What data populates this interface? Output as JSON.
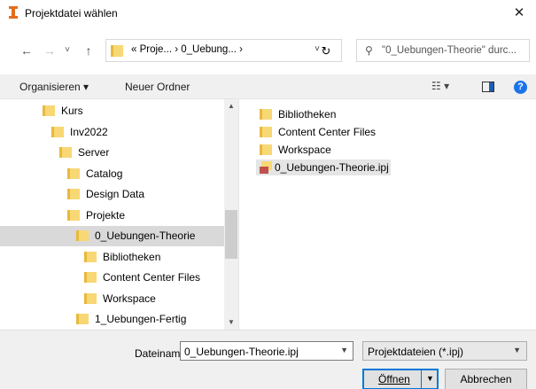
{
  "window": {
    "title": "Projektdatei wählen",
    "close": "✕"
  },
  "nav": {
    "back": "←",
    "forward": "→",
    "recent": "˅",
    "up": "↑",
    "address": "« Proje... › 0_Uebung... ›",
    "address_dropdown": "˅",
    "refresh": "↻",
    "search_placeholder": "\"0_Uebungen-Theorie\" durc..."
  },
  "toolbar": {
    "organize": "Organisieren ▾",
    "new_folder": "Neuer Ordner",
    "view": "☷ ▾",
    "help": "?"
  },
  "tree": {
    "items": [
      {
        "label": "Kurs",
        "indent": 1
      },
      {
        "label": "Inv2022",
        "indent": 2
      },
      {
        "label": "Server",
        "indent": 3
      },
      {
        "label": "Catalog",
        "indent": 4
      },
      {
        "label": "Design Data",
        "indent": 4
      },
      {
        "label": "Projekte",
        "indent": 4
      },
      {
        "label": "0_Uebungen-Theorie",
        "indent": 5,
        "selected": true
      },
      {
        "label": "Bibliotheken",
        "indent": 6
      },
      {
        "label": "Content Center Files",
        "indent": 6
      },
      {
        "label": "Workspace",
        "indent": 6
      },
      {
        "label": "1_Uebungen-Fertig",
        "indent": 5
      }
    ]
  },
  "files": {
    "items": [
      {
        "label": "Bibliotheken",
        "type": "folder"
      },
      {
        "label": "Content Center Files",
        "type": "folder"
      },
      {
        "label": "Workspace",
        "type": "folder"
      },
      {
        "label": "0_Uebungen-Theorie.ipj",
        "type": "ipj",
        "selected": true
      }
    ]
  },
  "bottom": {
    "filename_label": "Dateiname:",
    "filename_value": "0_Uebungen-Theorie.ipj",
    "filetype_value": "Projektdateien (*.ipj)",
    "open_button": "Öffnen",
    "cancel_button": "Abbrechen"
  },
  "colors": {
    "folder": "#f8d775",
    "folder_dark": "#e8b93c",
    "accent": "#0078d7",
    "selected": "#d9d9d9"
  }
}
